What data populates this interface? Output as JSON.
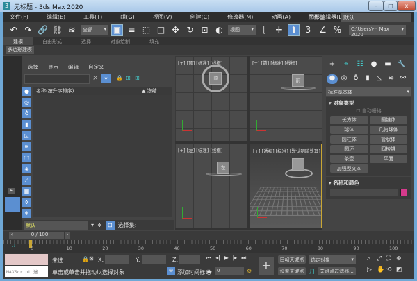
{
  "title": "无标题 - 3ds Max 2020",
  "window_controls": [
    "–",
    "□",
    "x"
  ],
  "menu": [
    "文件(F)",
    "编辑(E)",
    "工具(T)",
    "组(G)",
    "视图(V)",
    "创建(C)",
    "修改器(M)",
    "动画(A)",
    "图形编辑器(D)"
  ],
  "workspace": {
    "label": "工作区:",
    "value": "默认"
  },
  "toolbar": {
    "filter": "全部",
    "ref_coord": "视图",
    "path": "C:\\Users\\··· Max 2020"
  },
  "ribbon": {
    "tabs": [
      "建模",
      "自由形式",
      "选择",
      "对象绘制",
      "填充"
    ],
    "sub": "多边形建模"
  },
  "scene_explorer": {
    "menu": [
      "选择",
      "显示",
      "编辑",
      "自定义"
    ],
    "col_name": "名称(按升序排序)",
    "col_frozen": "▲ 冻结",
    "layer": "默认",
    "selection_set": "选择集:"
  },
  "viewports": [
    {
      "label": "[+] [顶] [标准] [线框]",
      "cube_label": "顶"
    },
    {
      "label": "[+] [前] [标准] [线框]",
      "cube_label": "前"
    },
    {
      "label": "[+] [左] [标准] [线框]",
      "cube_label": "左"
    },
    {
      "label": "[+] [透视] [标准] [默认明暗处理]"
    }
  ],
  "command_panel": {
    "category": "标准基本体",
    "object_type": "对象类型",
    "auto_grid": "自动栅格",
    "buttons": [
      "长方体",
      "圆锥体",
      "球体",
      "几何球体",
      "圆柱体",
      "管状体",
      "圆环",
      "四棱锥",
      "茶壶",
      "平面",
      "加强型文本"
    ],
    "name_color": "名称和颜色",
    "swatch_color": "#d63a8c"
  },
  "time": {
    "frame": "0 / 100",
    "ticks": [
      "0",
      "10",
      "20",
      "30",
      "40",
      "50",
      "60",
      "70",
      "80",
      "90",
      "100"
    ]
  },
  "status": {
    "maxscript": "MAXScript 迷",
    "selected": "未选",
    "x": "X:",
    "y": "Y:",
    "z": "Z:",
    "prompt": "单击或单击并拖动以选择对象",
    "add_time_tag": "添加时间标记",
    "frame_value": "0",
    "auto_key": "自动关键点",
    "set_key": "设置关键点",
    "key_mode": "选定对象",
    "key_filters": "关键点过滤器..."
  }
}
